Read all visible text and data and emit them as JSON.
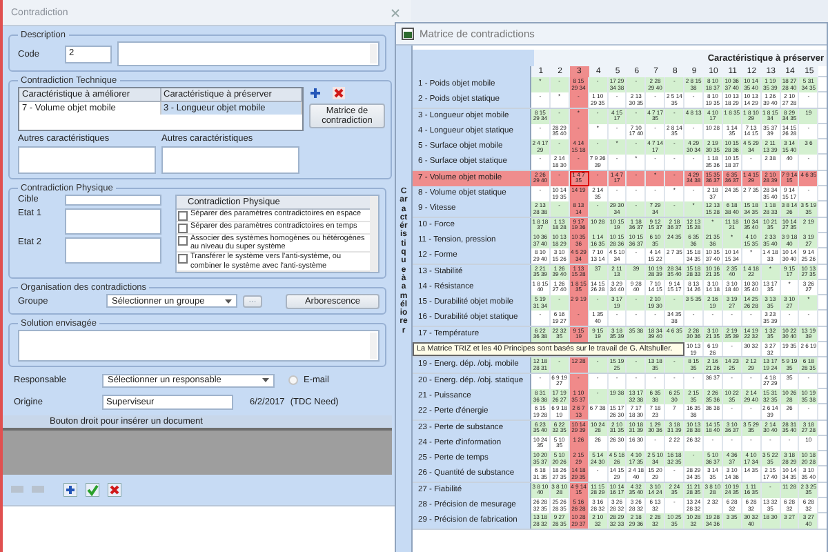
{
  "left_window": {
    "title": "Contradiction",
    "description": {
      "legend": "Description",
      "code_label": "Code",
      "code": "2"
    },
    "technical": {
      "legend": "Contradiction Technique",
      "columns": [
        "Caractéristique à améliorer",
        "Caractéristique à préserver"
      ],
      "rows": [
        [
          "7 - Volume objet mobile",
          "3 - Longueur objet mobile"
        ]
      ],
      "matrix_button": "Matrice de contradiction",
      "others": [
        "Autres caractéristiques",
        "Autres caractéristiques"
      ]
    },
    "physical": {
      "legend": "Contradiction Physique",
      "fields": [
        "Cible",
        "Etat 1",
        "Etat 2"
      ],
      "list_header": "Contradiction Physique",
      "items": [
        {
          "label": "Séparer des paramètres contradictoires en espace",
          "checked": false
        },
        {
          "label": "Séparer des paramètres contradictoires en temps",
          "checked": false
        },
        {
          "label": "Associer des systèmes homogènes ou hétérogènes au niveau du super système",
          "checked": false
        },
        {
          "label": "Transférer le système vers l'anti-système, ou combiner le système avec l'anti-système",
          "checked": false
        }
      ]
    },
    "organisation": {
      "legend": "Organisation des contradictions",
      "group_label": "Groupe",
      "group_value": "Sélectionner un groupe",
      "more_button": "...",
      "tree_button": "Arborescence"
    },
    "solution": {
      "legend": "Solution envisagée"
    },
    "responsable": {
      "label": "Responsable",
      "value": "Sélectionner un responsable",
      "email": {
        "label": "E-mail",
        "checked": false
      }
    },
    "origine": {
      "label": "Origine",
      "value": "Superviseur",
      "date": "6/2/2017",
      "source": "(TDC Need)"
    },
    "documents": {
      "header": "Bouton droit pour insérer un document"
    }
  },
  "matrix_window": {
    "title": "Matrice de contradictions",
    "side_label": "Caractéristique à améliorer",
    "header": "Caractéristique à préserver",
    "columns": [
      {
        "label": "1",
        "selected": false
      },
      {
        "label": "2",
        "selected": false
      },
      {
        "label": "3",
        "selected": true
      },
      {
        "label": "4",
        "selected": false
      },
      {
        "label": "5",
        "selected": false
      },
      {
        "label": "6",
        "selected": false
      },
      {
        "label": "7",
        "selected": false
      },
      {
        "label": "8",
        "selected": false
      },
      {
        "label": "9",
        "selected": false
      },
      {
        "label": "10",
        "selected": false
      },
      {
        "label": "11",
        "selected": false
      },
      {
        "label": "12",
        "selected": false
      },
      {
        "label": "13",
        "selected": false
      },
      {
        "label": "14",
        "selected": false
      },
      {
        "label": "15",
        "selected": false
      }
    ],
    "rows": [
      {
        "label": "1 - Poids objet mobile",
        "selected": false,
        "shaded": true,
        "cells": [
          "*",
          "-",
          "8 15 29 34",
          "-",
          "17 29 34 38",
          "-",
          "2 28 29 40",
          "-",
          "2 8 15 38",
          "8 10 18 37",
          "10 36 37 40",
          "10 14 35 40",
          "1 19 35 39",
          "18 27 28 40",
          "5 31 34 35"
        ]
      },
      {
        "label": "2 - Poids objet statique",
        "selected": false,
        "shaded": false,
        "cells": [
          "-",
          "*",
          "-",
          "1 10 29 35",
          "-",
          "2 13 30 35",
          "-",
          "2 5 14 35",
          "-",
          "8 10 19 35",
          "10 13 18 29",
          "10 13 14 29",
          "1 26 39 40",
          "2 10 27 28",
          "-"
        ]
      },
      {
        "label": "3 - Longueur objet mobile",
        "selected": false,
        "shaded": true,
        "cells": [
          "8 15 29 34",
          "-",
          "*",
          "-",
          "4 15 17",
          "-",
          "4 7 17 35",
          "-",
          "4 8 13",
          "4 10 17",
          "1 8 35",
          "1 8 10 29",
          "1 8 15 34",
          "8 29 34 35",
          "19"
        ]
      },
      {
        "label": "4 - Longueur objet statique",
        "selected": false,
        "shaded": false,
        "cells": [
          "-",
          "28 29 35 40",
          "-",
          "*",
          "-",
          "7 10 17 40",
          "-",
          "2 8 14 35",
          "-",
          "10 28",
          "1 14 35",
          "7 13 14 15",
          "35 37 39",
          "14 15 26 28",
          "-"
        ]
      },
      {
        "label": "5 - Surface objet mobile",
        "selected": false,
        "shaded": true,
        "cells": [
          "2 4 17 29",
          "-",
          "4 14 15 18",
          "-",
          "*",
          "-",
          "4 7 14 17",
          "-",
          "4 29 30 34",
          "2 19 30 35",
          "10 15 28 36",
          "4 5 29 34",
          "2 11 13 39",
          "3 14 15 40",
          "3 6"
        ]
      },
      {
        "label": "6 - Surface objet statique",
        "selected": false,
        "shaded": false,
        "cells": [
          "-",
          "2 14 18 30",
          "-",
          "7 9 26 39",
          "-",
          "*",
          "-",
          "-",
          "-",
          "1 18 35 36",
          "10 15 18 37",
          "-",
          "2 38",
          "40",
          "-"
        ]
      },
      {
        "label": "7 - Volume objet mobile",
        "selected": true,
        "shaded": true,
        "cells": [
          "2 26 29 40",
          "-",
          "1 4 7 35",
          "-",
          "1 4 7 17",
          "-",
          "*",
          "-",
          "4 29 34 38",
          "15 35 36 37",
          "6 35 36 37",
          "1 4 15 29",
          "2 10 28 39",
          "7 9 14 15",
          "4 6 35"
        ]
      },
      {
        "label": "8 - Volume objet statique",
        "selected": false,
        "shaded": false,
        "cells": [
          "-",
          "10 14 19 35",
          "14 19",
          "2 14 35",
          "-",
          "-",
          "-",
          "*",
          "-",
          "2 18 37",
          "24 35",
          "2 7 35",
          "28 34 35 40",
          "9 14 15 17",
          "-"
        ]
      },
      {
        "label": "9 - Vitesse",
        "selected": false,
        "shaded": true,
        "cells": [
          "2 13 28 38",
          "-",
          "8 13 14",
          "-",
          "29 30 34",
          "-",
          "7 29 34",
          "-",
          "*",
          "12 13 15 28",
          "6 18 38 40",
          "15 18 34 35",
          "1 18 28 33",
          "3 8 14 26",
          "3 5 19 35"
        ]
      },
      {
        "label": "10 - Force",
        "selected": false,
        "shaded": true,
        "cells": [
          "1 8 18 37",
          "1 13 18 28",
          "9 17 19 36",
          "10 28",
          "10 15 19",
          "1 18 36 37",
          "9 12 15 37",
          "2 18 36 37",
          "12 13 15 28",
          "*",
          "11 18 21",
          "10 34 35 40",
          "10 21 35",
          "10 14 27 35",
          "2 19"
        ]
      },
      {
        "label": "11 - Tension, pression",
        "selected": false,
        "shaded": true,
        "cells": [
          "10 36 37 40",
          "10 13 18 29",
          "10 35 36",
          "1 14 16 35",
          "10 15 28 36",
          "10 15 36 37",
          "6 10 35",
          "24 35",
          "6 35 36",
          "21 35 36",
          "*",
          "4 10 15 35",
          "2 33 35 40",
          "3 9 18 40",
          "3 19 27"
        ]
      },
      {
        "label": "12 - Forme",
        "selected": false,
        "shaded": false,
        "cells": [
          "8 10 29 40",
          "3 10 15 26",
          "4 5 29 34",
          "7 10 13 14",
          "4 5 10 34",
          "-",
          "4 14 15 22",
          "2 7 35",
          "15 18 34 35",
          "10 35 37 40",
          "10 14 15 34",
          "*",
          "1 4 18 33",
          "10 14 30 40",
          "9 14 25 26"
        ]
      },
      {
        "label": "13 - Stabilité",
        "selected": false,
        "shaded": true,
        "cells": [
          "2 21 35 39",
          "1 26 39 40",
          "1 13 15 28",
          "37",
          "2 11 13",
          "39",
          "10 19 28 39",
          "28 34 35 40",
          "15 18 28 33",
          "10 16 21 35",
          "2 35 40",
          "1 4 18 22",
          "*",
          "9 15 17",
          "10 13 27 35"
        ]
      },
      {
        "label": "14 - Résistance",
        "selected": false,
        "shaded": false,
        "cells": [
          "1 8 15 40",
          "1 26 27 40",
          "1 8 15 35",
          "14 15 26 28",
          "3 29 34 40",
          "9 28 40",
          "7 10 14 15",
          "9 14 15 17",
          "8 13 14 26",
          "3 10 14 18",
          "3 10 18 40",
          "10 30 35 40",
          "13 17 35",
          "*",
          "3 26 27"
        ]
      },
      {
        "label": "15 - Durabilité objet mobile",
        "selected": false,
        "shaded": true,
        "cells": [
          "5 19 31 34",
          "-",
          "2 9 19",
          "-",
          "3 17 19",
          "-",
          "2 10 19 30",
          "-",
          "3 5 35",
          "2 16 19",
          "3 19 27",
          "14 25 26 28",
          "3 13 35",
          "3 10 27",
          "*"
        ]
      },
      {
        "label": "16 - Durabilité objet statique",
        "selected": false,
        "shaded": false,
        "cells": [
          "-",
          "6 16 19 27",
          "-",
          "1 35 40",
          "-",
          "-",
          "-",
          "34 35 38",
          "-",
          "-",
          "-",
          "-",
          "3 23 35 39",
          "-",
          "-"
        ]
      },
      {
        "label": "17 - Température",
        "selected": false,
        "shaded": true,
        "cells": [
          "6 22 36 38",
          "22 32 35",
          "9 15 19",
          "9 15 19",
          "3 18 35 39",
          "35 38",
          "18 34 39 40",
          "4 6 35",
          "2 28 30 36",
          "3 10 21 35",
          "2 19 35 39",
          "14 19 22 32",
          "1 32 35",
          "10 22 30 40",
          "13 19 39"
        ]
      },
      {
        "shaded": false,
        "tooltip": "La Matrice TRIZ et les 40 Principes sont basés sur le travail de G. Altshuller.",
        "cells": [
          null,
          null,
          null,
          null,
          null,
          null,
          null,
          null,
          "10 13 19",
          "6 19 26",
          "-",
          "30 32",
          "3 27 32",
          "19 35",
          "2 6 19"
        ]
      },
      {
        "label": "19 - Energ. dép. /obj. mobile",
        "selected": false,
        "shaded": true,
        "cells": [
          "12 18 28 31",
          "-",
          "12 28",
          "-",
          "15 19 25",
          "-",
          "13 18 35",
          "-",
          "8 15 35",
          "2 16 21 26",
          "14 23 25",
          "2 12 29",
          "13 17 19 24",
          "5 9 19 35",
          "6 18 28 35"
        ]
      },
      {
        "label": "20 - Energ. dép. /obj. statique",
        "selected": false,
        "shaded": false,
        "cells": [
          "-",
          "6 9 19 27",
          "-",
          "-",
          "-",
          "-",
          "-",
          "-",
          "-",
          "36 37",
          "-",
          "-",
          "4 18 27 29",
          "35",
          "-"
        ]
      },
      {
        "label": "21 - Puissance",
        "selected": false,
        "shaded": true,
        "cells": [
          "8 31 36 38",
          "17 19 26 27",
          "1 10 35 37",
          "-",
          "19 38",
          "13 17 32 38",
          "6 35 38",
          "6 25 30",
          "2 15 35",
          "2 26 35 36",
          "10 22 35",
          "2 14 29 40",
          "15 31 32 35",
          "10 26 28",
          "10 19 35 38"
        ]
      },
      {
        "label": "22 - Perte d'énergie",
        "selected": false,
        "shaded": false,
        "cells": [
          "6 15 19 28",
          "6 9 18 19",
          "2 6 7 13",
          "6 7 38",
          "15 17 26 30",
          "7 17 18 30",
          "7 18 23",
          "7",
          "16 35 38",
          "36 38",
          "-",
          "-",
          "2 6 14 39",
          "26",
          "-"
        ]
      },
      {
        "label": "23 - Perte de substance",
        "selected": false,
        "shaded": true,
        "cells": [
          "6 23 35 40",
          "6 22 32 35",
          "10 14 29 39",
          "10 24 28",
          "2 10 31 35",
          "10 18 31 39",
          "1 29 30 36",
          "3 18 31 39",
          "10 13 28 38",
          "14 15 18 40",
          "3 10 36 37",
          "3 5 29 35",
          "2 14 30 40",
          "28 31 35 40",
          "3 18 27 28"
        ]
      },
      {
        "label": "24 - Perte d'information",
        "selected": false,
        "shaded": false,
        "cells": [
          "10 24 35",
          "5 10 35",
          "1 26",
          "26",
          "26 30",
          "16 30",
          "-",
          "2 22",
          "26 32",
          "-",
          "-",
          "-",
          "-",
          "-",
          "10"
        ]
      },
      {
        "label": "25 - Perte de temps",
        "selected": false,
        "shaded": true,
        "cells": [
          "10 20 35 37",
          "5 10 20 26",
          "2 15 29",
          "5 14 24 30",
          "4 5 16 26",
          "4 10 17 35",
          "2 5 10 34",
          "16 18 32 35",
          "-",
          "5 10 36 37",
          "4 36 37",
          "4 10 17 34",
          "3 5 22 35",
          "3 18 28 29",
          "10 18 20 28"
        ]
      },
      {
        "label": "26 - Quantité de substance",
        "selected": false,
        "shaded": false,
        "cells": [
          "6 18 31 35",
          "18 26 27 35",
          "14 18 29 35",
          "-",
          "14 15 29",
          "2 4 18 40",
          "15 20 29",
          "-",
          "28 29 34 35",
          "3 14 35",
          "3 10 14 36",
          "14 35",
          "2 15 17 40",
          "10 14 34 35",
          "3 10 35 40"
        ]
      },
      {
        "label": "27 - Fiabilité",
        "selected": false,
        "shaded": true,
        "cells": [
          "3 8 10 40",
          "3 8 10 28",
          "4 9 14 15",
          "11 15 28 29",
          "10 14 16 17",
          "4 32 35 40",
          "3 10 14 24",
          "2 24 35",
          "11 21 28 35",
          "3 8 10 28",
          "10 19 24 35",
          "1 11 16 35",
          "-",
          "11 28",
          "2 3 25 35"
        ]
      },
      {
        "label": "28 - Précision de mesurage",
        "selected": false,
        "shaded": false,
        "cells": [
          "26 28 32 35",
          "25 26 28 35",
          "5 16 26 28",
          "3 16 28 32",
          "3 26 28 32",
          "3 26 28 32",
          "6 13 32",
          "-",
          "13 24 28 32",
          "2 32",
          "6 28 32",
          "6 28 32",
          "13 32 35",
          "6 28 32",
          "6 28 32"
        ]
      },
      {
        "label": "29 - Précision de fabrication",
        "selected": false,
        "shaded": true,
        "cells": [
          "13 18 28 32",
          "9 27 28 35",
          "10 28 29 37",
          "2 10 32",
          "28 29 32 33",
          "2 18 29 36",
          "2 28 32",
          "10 25 35",
          "10 28 32",
          "19 28 34 36",
          "3 35",
          "30 32 40",
          "18 30",
          "3 27",
          "3 27 40"
        ]
      }
    ]
  }
}
